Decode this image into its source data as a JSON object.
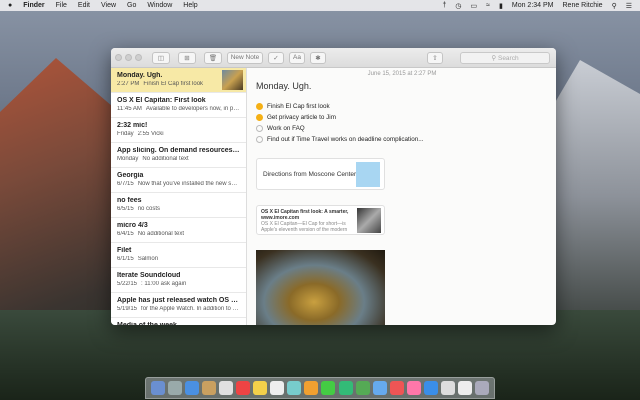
{
  "menubar": {
    "apple": "",
    "items": [
      "Finder",
      "File",
      "Edit",
      "View",
      "Go",
      "Window",
      "Help"
    ],
    "clock": "Mon 2:34 PM",
    "user": "Rene Ritchie"
  },
  "toolbar": {
    "new_note": "New Note",
    "font": "Aa",
    "search_placeholder": "Search"
  },
  "notes": [
    {
      "title": "Monday. Ugh.",
      "date": "2:27 PM",
      "preview": "Finish El Cap first look",
      "selected": true
    },
    {
      "title": "OS X El Capitan: First look",
      "date": "11:45 AM",
      "preview": "Available to developers now, in pub..."
    },
    {
      "title": "2:32 mic!",
      "date": "Friday",
      "preview": "2:55 Vicki"
    },
    {
      "title": "App slicing. On demand resources. Bit...",
      "date": "Monday",
      "preview": "No additional text"
    },
    {
      "title": "Georgia",
      "date": "6/7/15",
      "preview": "Now that you've installed the new sm..."
    },
    {
      "title": "no fees",
      "date": "6/5/15",
      "preview": "no costs"
    },
    {
      "title": "micro 4/3",
      "date": "6/4/15",
      "preview": "No additional text"
    },
    {
      "title": "Filet",
      "date": "6/1/15",
      "preview": "Salmon"
    },
    {
      "title": "Iterate Soundcloud",
      "date": "5/22/15",
      "preview": ": 11:00 ask again"
    },
    {
      "title": "Apple has just released watch OS 1.0.1,...",
      "date": "5/19/15",
      "preview": "for the Apple Watch. In addition to p..."
    },
    {
      "title": "Media of the week",
      "date": "",
      "preview": ""
    }
  ],
  "editor": {
    "date": "June 15, 2015 at 2:27 PM",
    "title": "Monday. Ugh.",
    "checklist": [
      {
        "text": "Finish El Cap first look",
        "done": true
      },
      {
        "text": "Get privacy article to Jim",
        "done": true
      },
      {
        "text": "Work on FAQ",
        "done": false
      },
      {
        "text": "Find out if Time Travel works on deadline complication...",
        "done": false
      }
    ],
    "map_card": "Directions from Moscone Center",
    "link_card": {
      "title": "OS X El Capitan first look: A smarter,",
      "site": "www.imore.com",
      "desc1": "OS X El Capitan—El Cap for short—is",
      "desc2": "Apple's eleventh version of the modern"
    }
  },
  "colors": {
    "accent": "#f5b015",
    "selected_row": "#f7e9a6"
  }
}
